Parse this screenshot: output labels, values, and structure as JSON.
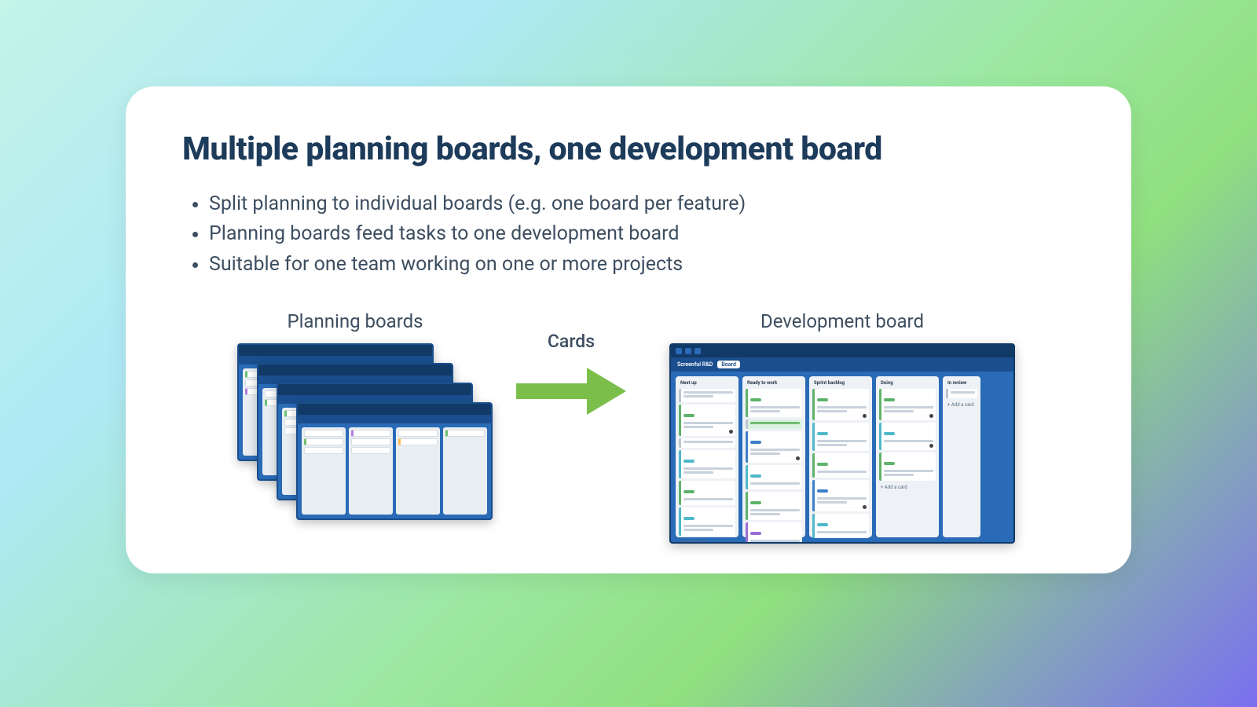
{
  "title": "Multiple planning boards, one development board",
  "bullets": [
    "Split planning to individual boards (e.g. one board per feature)",
    "Planning boards feed tasks to one development board",
    "Suitable for one team working on one or more projects"
  ],
  "labels": {
    "planning": "Planning boards",
    "arrow": "Cards",
    "development": "Development board"
  },
  "dev_board": {
    "workspace": "Screenful R&D",
    "view_button": "Board",
    "lists": [
      "Next up",
      "Ready to work",
      "Sprint backlog",
      "Doing",
      "In review"
    ],
    "add_card": "+ Add a card"
  },
  "colors": {
    "arrow": "#7bbf4a",
    "board_bg": "#2a6bb7",
    "board_header": "#113a67"
  }
}
